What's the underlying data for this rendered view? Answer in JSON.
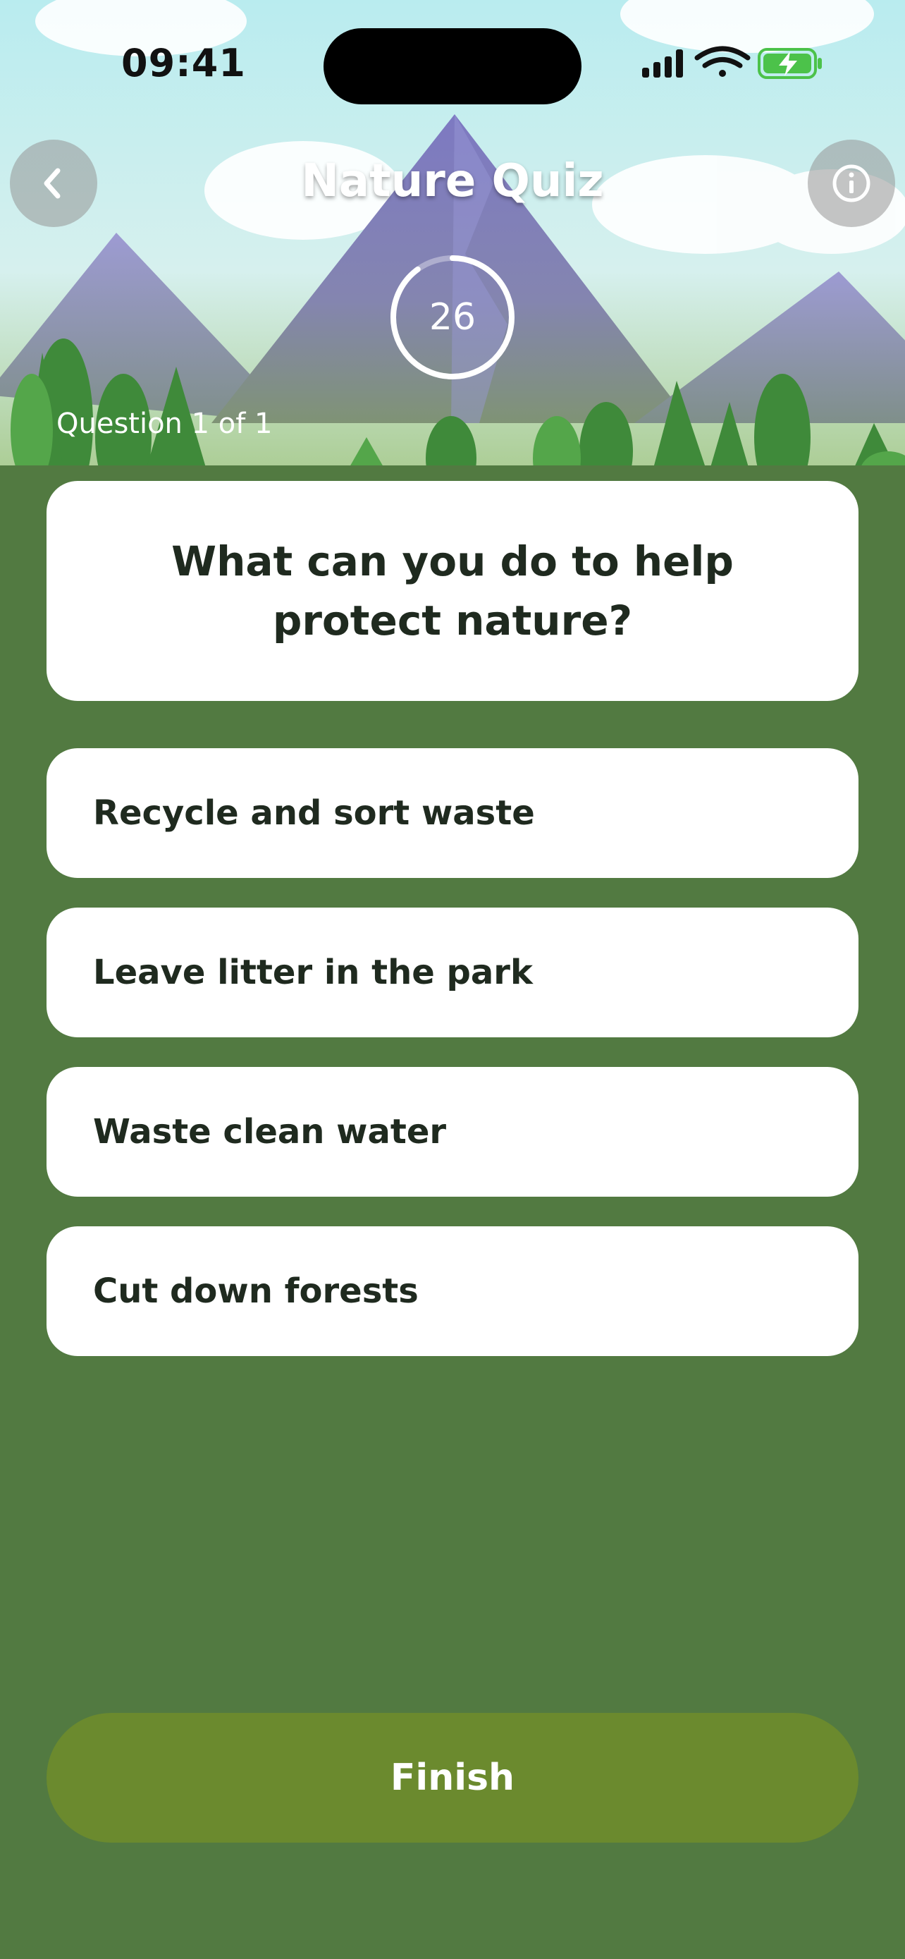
{
  "status_bar": {
    "time": "09:41",
    "icons": [
      "signal-icon",
      "wifi-icon",
      "battery-charging-icon"
    ]
  },
  "header": {
    "title": "Nature Quiz",
    "back_icon": "chevron-left-icon",
    "info_icon": "info-icon"
  },
  "timer": {
    "value": "26",
    "remaining_fraction": 0.9
  },
  "progress": {
    "label": "Question 1 of 1"
  },
  "question": {
    "text": "What can you do to help protect nature?"
  },
  "options": [
    {
      "label": "Recycle and sort waste"
    },
    {
      "label": "Leave litter in the park"
    },
    {
      "label": "Waste clean water"
    },
    {
      "label": "Cut down forests"
    }
  ],
  "footer": {
    "finish_label": "Finish"
  },
  "colors": {
    "background": "#527a41",
    "finish_button": "#6b8a2e",
    "card": "#ffffff",
    "text": "#1f2a1f",
    "sky": "#bfeaf0",
    "mountain": "#7e7bb8"
  }
}
